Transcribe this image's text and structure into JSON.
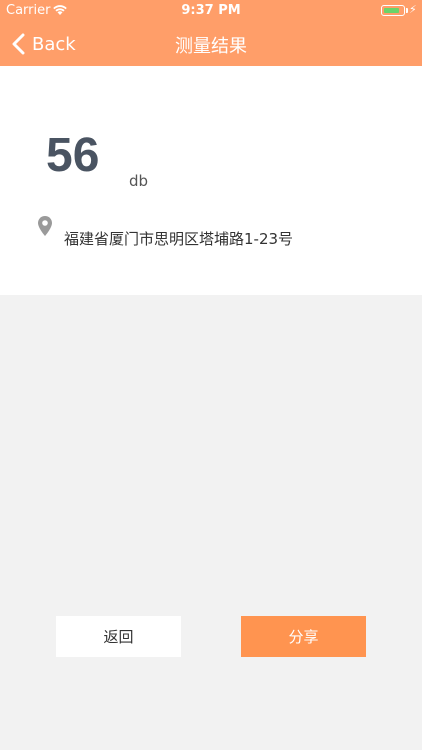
{
  "status_bar": {
    "carrier": "Carrier",
    "time": "9:37 PM",
    "battery_level": 0.85,
    "charging": true
  },
  "nav": {
    "back_label": "Back",
    "title": "测量结果"
  },
  "result": {
    "value": "56",
    "unit": "db",
    "address": "福建省厦门市思明区塔埔路1-23号"
  },
  "actions": {
    "return_label": "返回",
    "share_label": "分享"
  },
  "colors": {
    "header": "#FF9E69",
    "primary_button": "#FF9450",
    "value_text": "#4A5462"
  },
  "icons": {
    "back": "chevron-left-icon",
    "location": "map-pin-icon",
    "wifi": "wifi-icon",
    "battery": "battery-icon"
  }
}
